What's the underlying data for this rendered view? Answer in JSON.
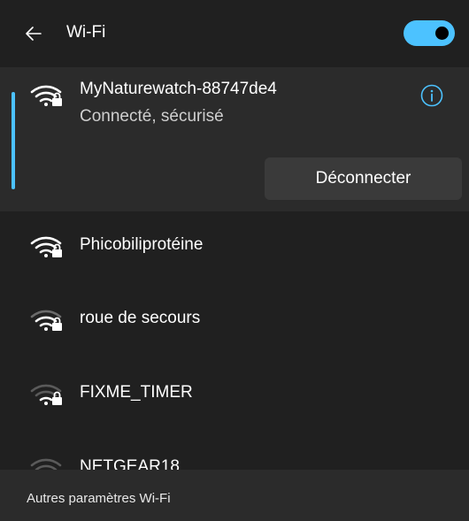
{
  "header": {
    "title": "Wi-Fi",
    "back_icon": "arrow-left-icon",
    "toggle_on": true,
    "accent_color": "#4cc2ff"
  },
  "connected_network": {
    "name": "MyNaturewatch-88747de4",
    "status": "Connecté, sécurisé",
    "disconnect_label": "Déconnecter",
    "info_icon": "info-icon",
    "signal_icon": "wifi-secured-icon"
  },
  "networks": [
    {
      "name": "Phicobiliprotéine",
      "signal_icon": "wifi-secured-icon"
    },
    {
      "name": "roue de secours",
      "signal_icon": "wifi-secured-icon"
    },
    {
      "name": "FIXME_TIMER",
      "signal_icon": "wifi-secured-icon"
    },
    {
      "name": "NETGEAR18",
      "signal_icon": "wifi-icon"
    }
  ],
  "footer": {
    "more_settings_label": "Autres paramètres Wi-Fi"
  }
}
